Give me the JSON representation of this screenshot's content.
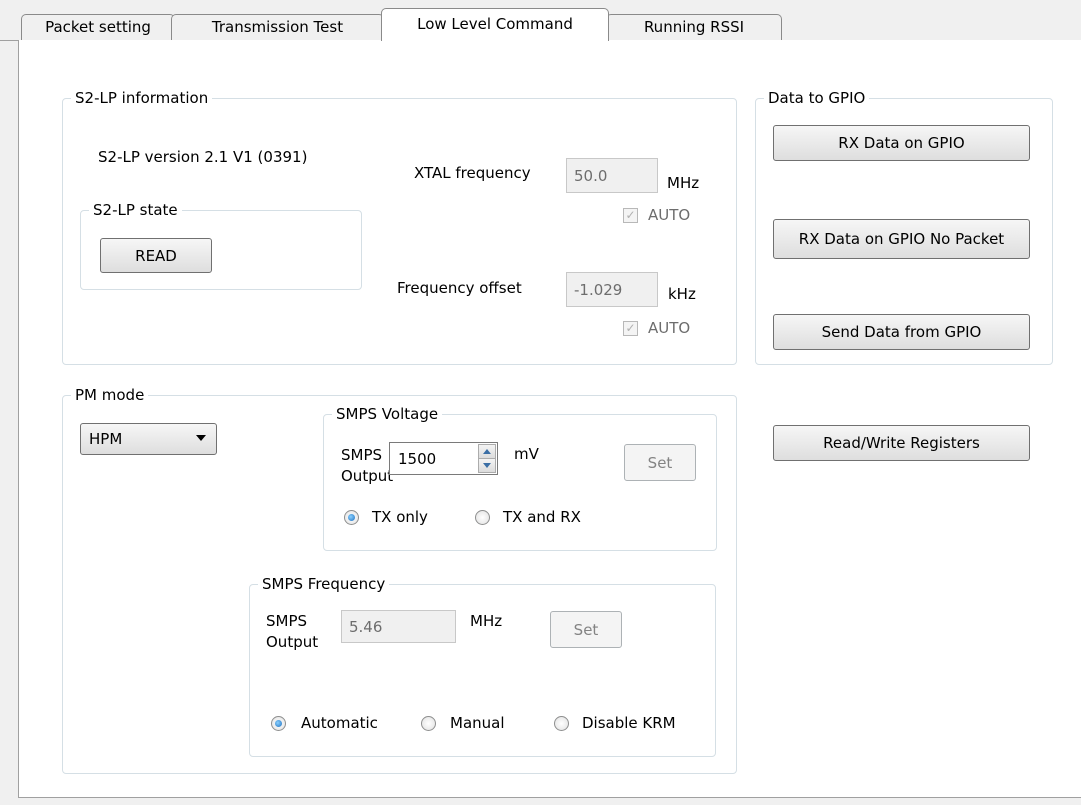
{
  "tabs": [
    {
      "label": "Packet setting",
      "active": false
    },
    {
      "label": "Transmission Test",
      "active": false
    },
    {
      "label": "Low Level Command",
      "active": true
    },
    {
      "label": "Running RSSI",
      "active": false
    }
  ],
  "s2lp_info": {
    "title": "S2-LP information",
    "version": "S2-LP version 2.1 V1 (0391)",
    "state_title": "S2-LP state",
    "read_button": "READ",
    "xtal_label": "XTAL frequency",
    "xtal_value": "50.0",
    "xtal_unit": "MHz",
    "xtal_auto_label": "AUTO",
    "xtal_auto_checked": true,
    "offset_label": "Frequency offset",
    "offset_value": "-1.029",
    "offset_unit": "kHz",
    "offset_auto_label": "AUTO",
    "offset_auto_checked": true
  },
  "gpio": {
    "title": "Data to GPIO",
    "rx_button": "RX Data on GPIO",
    "rx_no_packet_button": "RX Data on GPIO No Packet",
    "send_button": "Send Data from GPIO"
  },
  "registers_button": "Read/Write Registers",
  "pm_mode": {
    "title": "PM mode",
    "selected": "HPM"
  },
  "smps_voltage": {
    "title": "SMPS Voltage",
    "output_label_1": "SMPS",
    "output_label_2": "Output",
    "value": "1500",
    "unit": "mV",
    "set_button": "Set",
    "radio_tx_only": "TX only",
    "radio_tx_rx": "TX and RX",
    "selected": "TX only"
  },
  "smps_frequency": {
    "title": "SMPS Frequency",
    "output_label_1": "SMPS",
    "output_label_2": "Output",
    "value": "5.46",
    "unit": "MHz",
    "set_button": "Set",
    "radio_automatic": "Automatic",
    "radio_manual": "Manual",
    "radio_disable": "Disable KRM",
    "selected": "Automatic"
  }
}
